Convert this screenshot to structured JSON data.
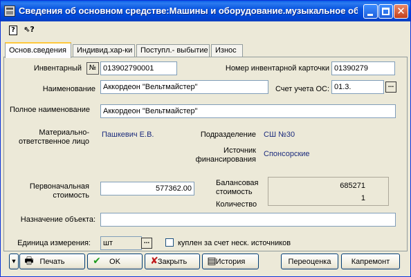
{
  "window": {
    "title": "Сведения об основном средстве:Машины и оборудование.музыкальное об..."
  },
  "toolbar": {
    "help_icon": "help-doc-icon",
    "whats_this_icon": "whats-this-icon",
    "help_glyph": "?",
    "whats_this_glyph": "⇖?"
  },
  "tabs": [
    {
      "label": "Основ.сведения",
      "active": true
    },
    {
      "label": "Индивид.хар-ки",
      "active": false
    },
    {
      "label": "Поступл.- выбытие",
      "active": false
    },
    {
      "label": "Износ",
      "active": false
    }
  ],
  "form": {
    "inventory_label": "Инвентарный",
    "inventory_number_btn": "№",
    "inventory_value": "013902790001",
    "card_number_label": "Номер инвентарной карточки",
    "card_number_value": "01390279",
    "name_label": "Наименование",
    "name_value": "Аккордеон \"Вельтмайстер\"",
    "account_label": "Счет учета ОС:",
    "account_value": "01.3.",
    "full_name_label": "Полное наименование",
    "full_name_value": "Аккордеон \"Вельтмайстер\"",
    "responsible_label_1": "Материально-",
    "responsible_label_2": "ответственное лицо",
    "responsible_value": "Пашкевич Е.В.",
    "department_label": "Подразделение",
    "department_value": "СШ №30",
    "source_label_1": "Источник",
    "source_label_2": "финансирования",
    "source_value": "Спонсорские",
    "initial_cost_label_1": "Первоначальная",
    "initial_cost_label_2": "стоимость",
    "initial_cost_value": "577362.00",
    "balance_label_1": "Балансовая",
    "balance_label_2": "стоимость",
    "balance_value": "685271",
    "quantity_label": "Количество",
    "quantity_value": "1",
    "purpose_label": "Назначение объекта:",
    "purpose_value": "",
    "unit_label": "Единица измерения:",
    "unit_value": "шт",
    "bought_label": "куплен за счет неск. источников",
    "bought_checked": false,
    "ellipsis": "..."
  },
  "buttons": {
    "arrow": "▼",
    "print": "Печать",
    "ok": "OK",
    "close": "Закрыть",
    "history": "История",
    "revaluation": "Переоценка",
    "repair": "Капремонт"
  },
  "icons": {
    "print": "🖶",
    "ok": "✔",
    "close": "✘",
    "history": "▤"
  }
}
